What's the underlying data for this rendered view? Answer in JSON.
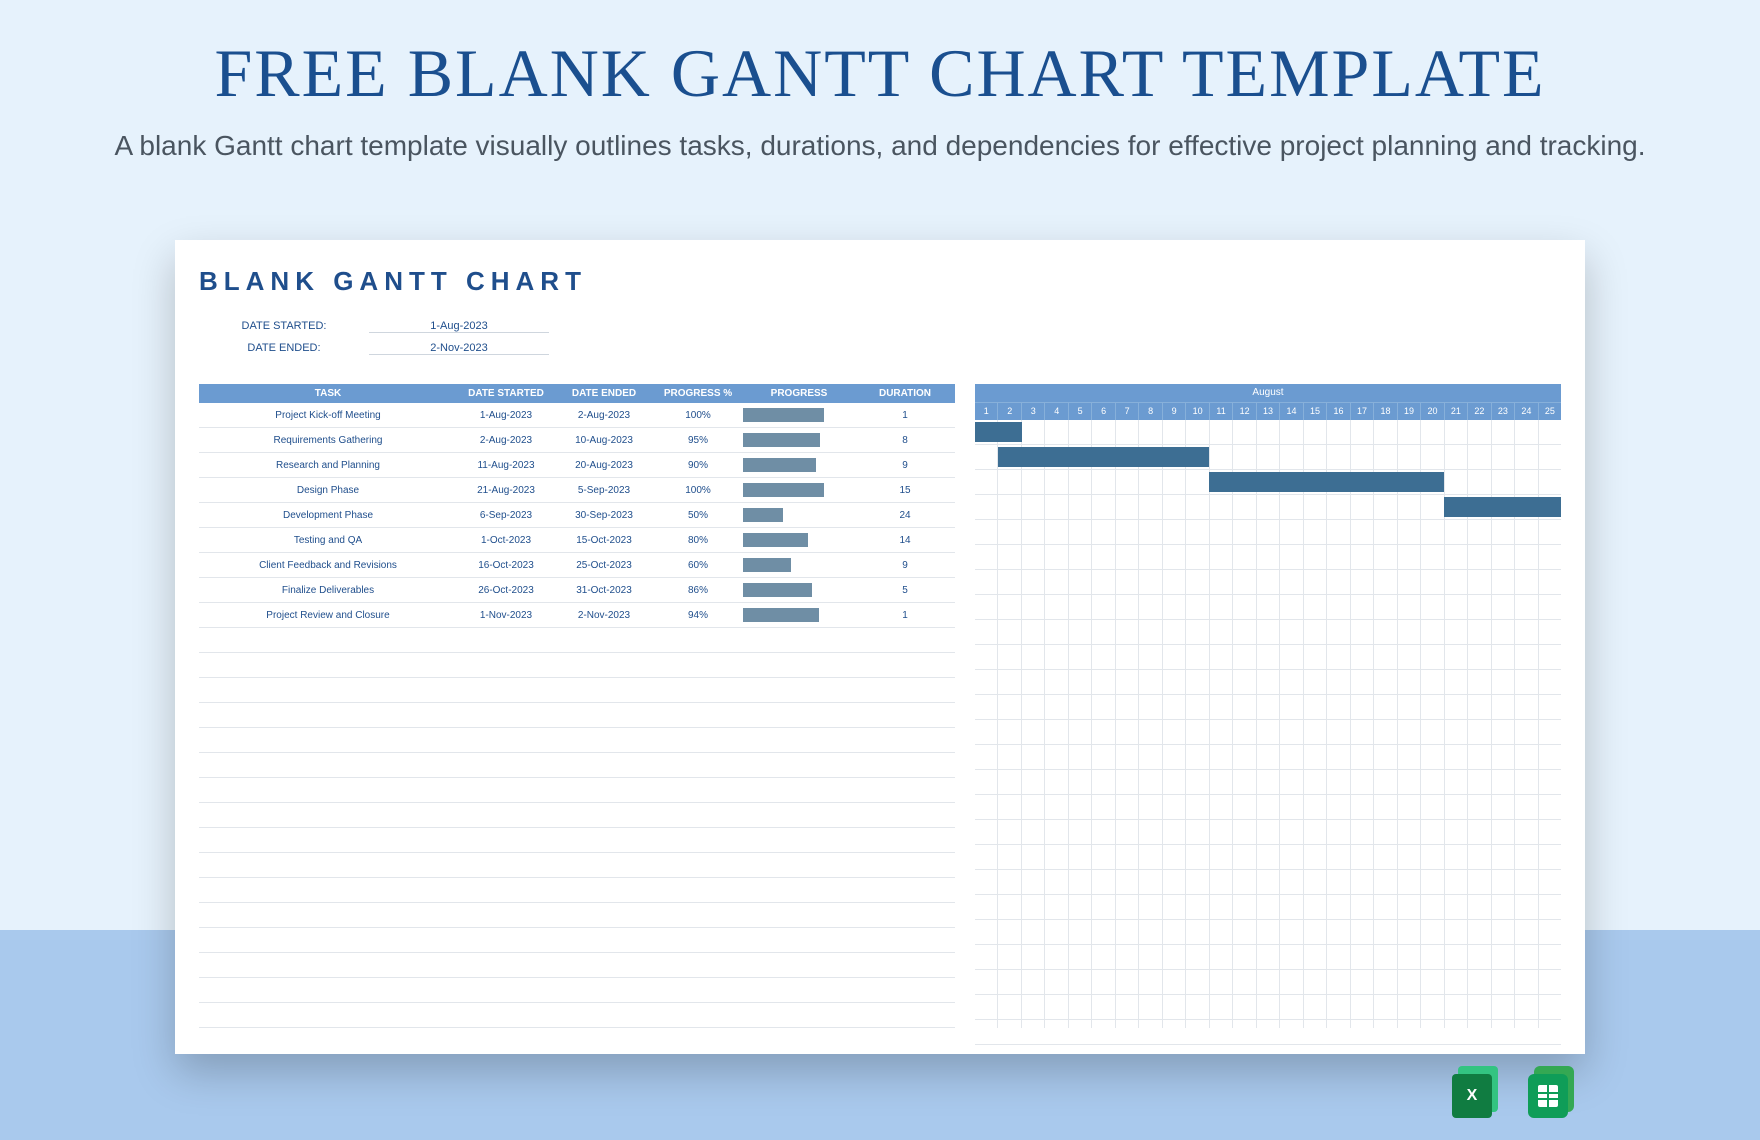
{
  "hero": {
    "title": "FREE BLANK GANTT CHART TEMPLATE",
    "subtitle": "A blank Gantt chart template visually outlines tasks, durations, and dependencies for effective project planning and tracking."
  },
  "doc": {
    "title": "BLANK GANTT CHART",
    "meta": {
      "date_started_label": "DATE STARTED:",
      "date_started_value": "1-Aug-2023",
      "date_ended_label": "DATE ENDED:",
      "date_ended_value": "2-Nov-2023"
    },
    "columns": {
      "task": "TASK",
      "date_started": "DATE STARTED",
      "date_ended": "DATE ENDED",
      "progress_pct": "PROGRESS %",
      "progress": "PROGRESS",
      "duration": "DURATION"
    }
  },
  "gantt": {
    "month": "August",
    "days": [
      1,
      2,
      3,
      4,
      5,
      6,
      7,
      8,
      9,
      10,
      11,
      12,
      13,
      14,
      15,
      16,
      17,
      18,
      19,
      20,
      21,
      22,
      23,
      24,
      25
    ]
  },
  "tasks": [
    {
      "name": "Project Kick-off Meeting",
      "start": "1-Aug-2023",
      "end": "2-Aug-2023",
      "progress": 100,
      "duration": 1,
      "gantt_start": 1,
      "gantt_end": 2
    },
    {
      "name": "Requirements Gathering",
      "start": "2-Aug-2023",
      "end": "10-Aug-2023",
      "progress": 95,
      "duration": 8,
      "gantt_start": 2,
      "gantt_end": 10
    },
    {
      "name": "Research and Planning",
      "start": "11-Aug-2023",
      "end": "20-Aug-2023",
      "progress": 90,
      "duration": 9,
      "gantt_start": 11,
      "gantt_end": 20
    },
    {
      "name": "Design Phase",
      "start": "21-Aug-2023",
      "end": "5-Sep-2023",
      "progress": 100,
      "duration": 15,
      "gantt_start": 21,
      "gantt_end": 25
    },
    {
      "name": "Development Phase",
      "start": "6-Sep-2023",
      "end": "30-Sep-2023",
      "progress": 50,
      "duration": 24,
      "gantt_start": null,
      "gantt_end": null
    },
    {
      "name": "Testing and QA",
      "start": "1-Oct-2023",
      "end": "15-Oct-2023",
      "progress": 80,
      "duration": 14,
      "gantt_start": null,
      "gantt_end": null
    },
    {
      "name": "Client Feedback and Revisions",
      "start": "16-Oct-2023",
      "end": "25-Oct-2023",
      "progress": 60,
      "duration": 9,
      "gantt_start": null,
      "gantt_end": null
    },
    {
      "name": "Finalize Deliverables",
      "start": "26-Oct-2023",
      "end": "31-Oct-2023",
      "progress": 86,
      "duration": 5,
      "gantt_start": null,
      "gantt_end": null
    },
    {
      "name": "Project Review and Closure",
      "start": "1-Nov-2023",
      "end": "2-Nov-2023",
      "progress": 94,
      "duration": 1,
      "gantt_start": null,
      "gantt_end": null
    }
  ],
  "blank_rows_left": 16,
  "blank_rows_right": 16,
  "downloads": {
    "excel_label": "X"
  },
  "chart_data": {
    "type": "bar",
    "title": "Blank Gantt Chart — task progress and August schedule",
    "progress_series": {
      "categories": [
        "Project Kick-off Meeting",
        "Requirements Gathering",
        "Research and Planning",
        "Design Phase",
        "Development Phase",
        "Testing and QA",
        "Client Feedback and Revisions",
        "Finalize Deliverables",
        "Project Review and Closure"
      ],
      "values": [
        100,
        95,
        90,
        100,
        50,
        80,
        60,
        86,
        94
      ],
      "xlabel": "",
      "ylabel": "Progress %",
      "ylim": [
        0,
        100
      ]
    },
    "gantt": {
      "x_axis": "Day of August",
      "x_range": [
        1,
        25
      ],
      "bars": [
        {
          "task": "Project Kick-off Meeting",
          "start": 1,
          "end": 2
        },
        {
          "task": "Requirements Gathering",
          "start": 2,
          "end": 10
        },
        {
          "task": "Research and Planning",
          "start": 11,
          "end": 20
        },
        {
          "task": "Design Phase",
          "start": 21,
          "end": 25
        }
      ]
    }
  }
}
